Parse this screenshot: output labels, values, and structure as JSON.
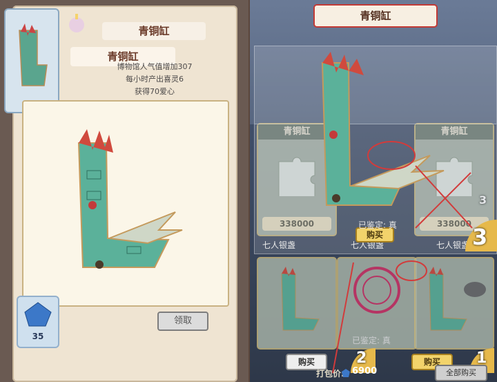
{
  "left": {
    "card_title": "青铜缸",
    "ribbon_title": "青铜缸",
    "info_lines": [
      "博物馆人气值增加307",
      "每小时产出喜灵6",
      "获得70爱心"
    ],
    "gem_count": "35",
    "claim_button": "领取"
  },
  "right": {
    "title": "青铜缸",
    "slots": [
      {
        "title": "青铜缸",
        "price": "338000",
        "badge": "2"
      },
      {
        "title": "青铜缸",
        "price": "338000",
        "badge": "3"
      }
    ],
    "lower_labels": [
      "七人银盏",
      "七人银盏",
      "七人银盏"
    ],
    "appraised_1": "已鉴定: 真",
    "appraised_2": "已鉴定: 真",
    "buy_label": "购买",
    "price_bottom": "6900",
    "price_bottom_label": "打包价:",
    "bottom_right_button": "全部购买",
    "annot_numbers": [
      "3",
      "2",
      "1"
    ]
  },
  "colors": {
    "accent_red": "#d23b3b",
    "jade": "#4fb09a",
    "gold": "#e6b94b"
  }
}
